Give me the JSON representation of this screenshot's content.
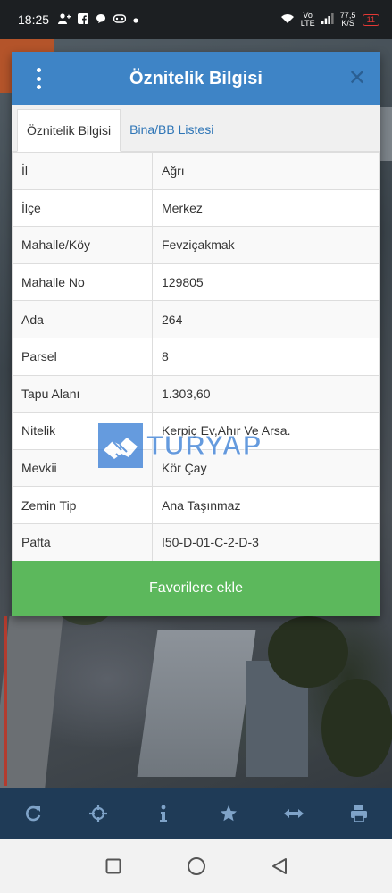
{
  "status_bar": {
    "time": "18:25",
    "network": "Vo LTE",
    "speed": "77,5 K/S",
    "battery": "11"
  },
  "dialog": {
    "title": "Öznitelik Bilgisi",
    "tabs": [
      {
        "label": "Öznitelik Bilgisi",
        "active": true
      },
      {
        "label": "Bina/BB Listesi",
        "active": false
      }
    ],
    "rows": [
      {
        "key": "İl",
        "value": "Ağrı"
      },
      {
        "key": "İlçe",
        "value": "Merkez"
      },
      {
        "key": "Mahalle/Köy",
        "value": "Fevziçakmak"
      },
      {
        "key": "Mahalle No",
        "value": "129805"
      },
      {
        "key": "Ada",
        "value": "264"
      },
      {
        "key": "Parsel",
        "value": "8"
      },
      {
        "key": "Tapu Alanı",
        "value": "1.303,60"
      },
      {
        "key": "Nitelik",
        "value": "Kerpiç Ev,Ahır Ve Arsa."
      },
      {
        "key": "Mevkii",
        "value": "Kör Çay"
      },
      {
        "key": "Zemin Tip",
        "value": "Ana Taşınmaz"
      },
      {
        "key": "Pafta",
        "value": "I50-D-01-C-2-D-3"
      }
    ],
    "favorite_button": "Favorilere ekle"
  },
  "watermark": {
    "text": "TURYAP"
  },
  "toolbar": {
    "icons": [
      "refresh-icon",
      "crosshair-icon",
      "info-icon",
      "star-icon",
      "measure-icon",
      "print-icon"
    ]
  },
  "colors": {
    "header": "#3e84c6",
    "button": "#5cb85c",
    "toolbar": "#1f3b57",
    "tab_link": "#2e75b6"
  }
}
